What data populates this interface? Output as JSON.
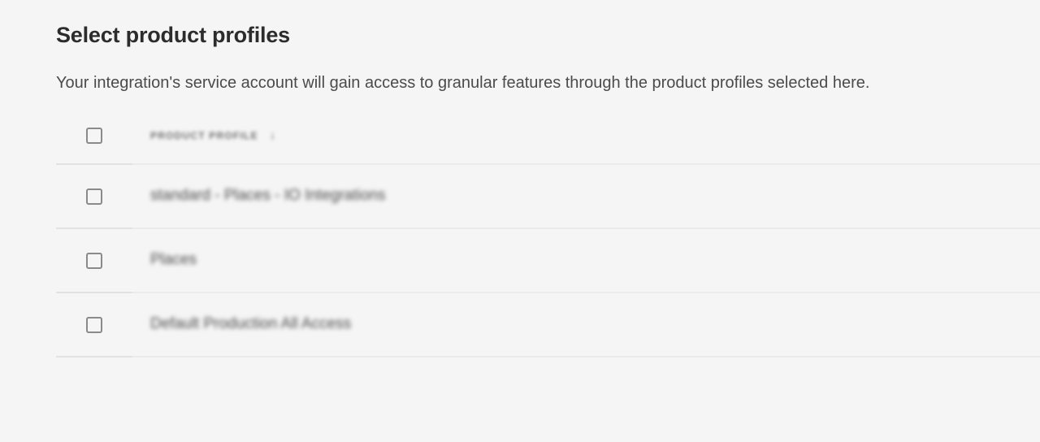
{
  "page": {
    "title": "Select product profiles",
    "description": "Your integration's service account will gain access to granular features through the product profiles selected here."
  },
  "table": {
    "header": {
      "column_label": "PRODUCT PROFILE",
      "sort_icon": "arrow-down-icon",
      "sort_glyph": "↓"
    },
    "rows": [
      {
        "name": "standard - Places - IO Integrations",
        "checked": false
      },
      {
        "name": "Places",
        "checked": false
      },
      {
        "name": "Default Production All Access",
        "checked": false
      }
    ]
  }
}
